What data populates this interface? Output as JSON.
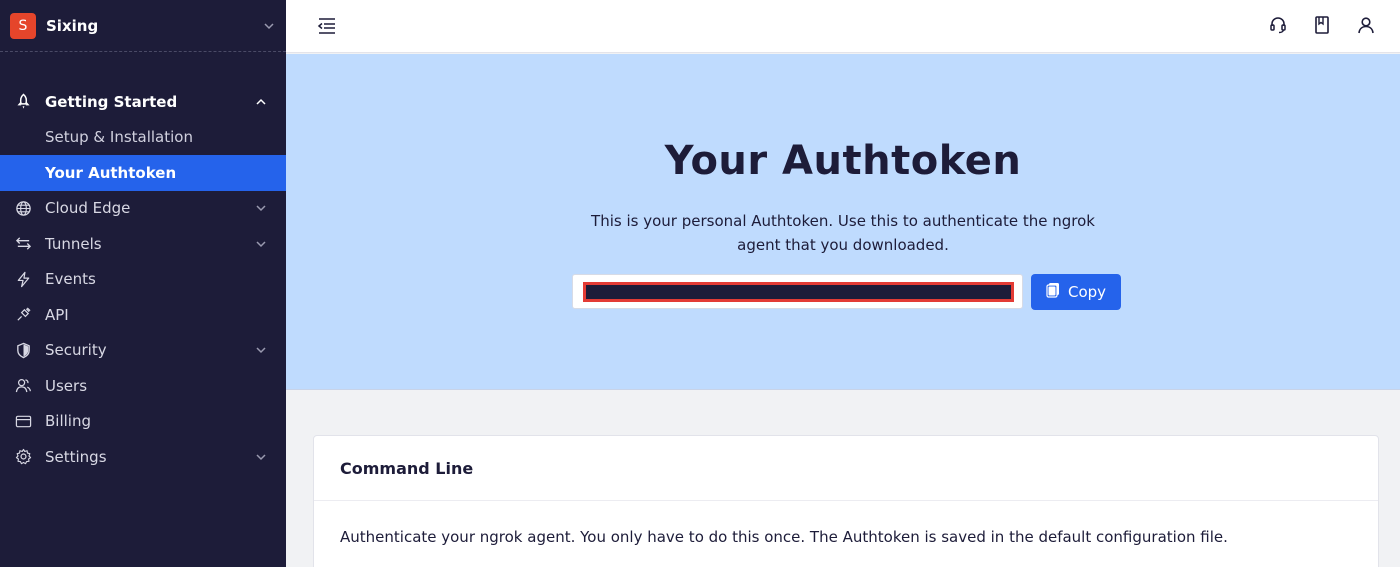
{
  "org": {
    "initial": "S",
    "name": "Sixing"
  },
  "sidebar": {
    "section": {
      "label": "Getting Started",
      "icon": "rocket-icon"
    },
    "sub_items": [
      {
        "label": "Setup & Installation",
        "active": false
      },
      {
        "label": "Your Authtoken",
        "active": true
      }
    ],
    "items": [
      {
        "label": "Cloud Edge",
        "icon": "globe-icon",
        "has_chevron": true
      },
      {
        "label": "Tunnels",
        "icon": "arrows-icon",
        "has_chevron": true
      },
      {
        "label": "Events",
        "icon": "lightning-icon",
        "has_chevron": false
      },
      {
        "label": "API",
        "icon": "plug-icon",
        "has_chevron": false
      },
      {
        "label": "Security",
        "icon": "shield-icon",
        "has_chevron": true
      },
      {
        "label": "Users",
        "icon": "users-icon",
        "has_chevron": false
      },
      {
        "label": "Billing",
        "icon": "card-icon",
        "has_chevron": false
      },
      {
        "label": "Settings",
        "icon": "gear-icon",
        "has_chevron": true
      }
    ]
  },
  "topbar": {
    "icons": [
      "collapse-sidebar-icon",
      "headset-icon",
      "book-icon",
      "user-icon"
    ]
  },
  "hero": {
    "title": "Your Authtoken",
    "description": "This is your personal Authtoken. Use this to authenticate the ngrok agent that you downloaded.",
    "copy_label": "Copy"
  },
  "card": {
    "title": "Command Line",
    "body": "Authenticate your ngrok agent. You only have to do this once. The Authtoken is saved in the default configuration file."
  },
  "colors": {
    "sidebar_bg": "#1d1c39",
    "accent": "#2563eb",
    "hero_bg": "#bfdbfe",
    "org_avatar": "#e5452b",
    "redaction_border": "#e33b35"
  }
}
